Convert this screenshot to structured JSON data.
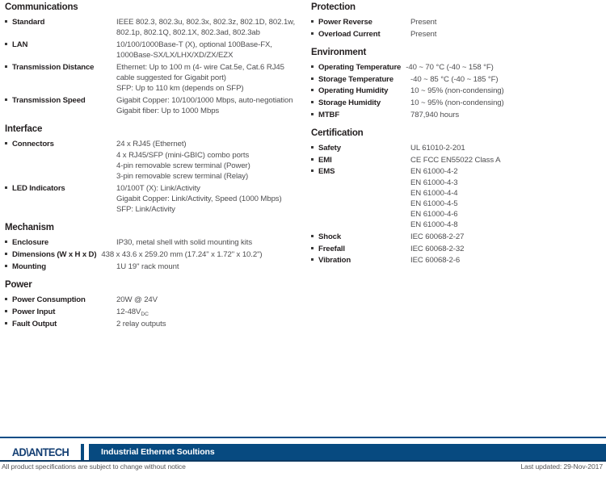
{
  "columns": {
    "left": [
      {
        "title": "Communications",
        "rows": [
          {
            "label": "Standard",
            "value": "IEEE 802.3, 802.3u, 802.3x, 802.3z, 802.1D, 802.1w,\n802.1p, 802.1Q, 802.1X, 802.3ad, 802.3ab"
          },
          {
            "label": "LAN",
            "value": "10/100/1000Base-T (X), optional 100Base-FX,\n1000Base-SX/LX/LHX/XD/ZX/EZX"
          },
          {
            "label": "Transmission Distance",
            "value": "Ethernet: Up to 100 m (4- wire Cat.5e, Cat.6 RJ45\ncable suggested for Gigabit port)\nSFP: Up to 110 km (depends on SFP)"
          },
          {
            "label": "Transmission Speed",
            "value": "Gigabit Copper: 10/100/1000 Mbps, auto-negotiation\nGigabit fiber: Up to 1000 Mbps"
          }
        ]
      },
      {
        "title": "Interface",
        "rows": [
          {
            "label": "Connectors",
            "value": "24 x RJ45 (Ethernet)\n4 x RJ45/SFP (mini-GBIC) combo ports\n4-pin removable screw terminal (Power)\n3-pin removable screw terminal (Relay)"
          },
          {
            "label": "LED Indicators",
            "value": "10/100T (X): Link/Activity\nGigabit Copper: Link/Activity, Speed (1000 Mbps)\nSFP: Link/Activity"
          }
        ]
      },
      {
        "title": "Mechanism",
        "rows": [
          {
            "label": "Enclosure",
            "value": "IP30, metal shell with solid mounting kits"
          },
          {
            "label": "Dimensions (W x H x D)",
            "value": "438 x 43.6 x 259.20 mm (17.24\" x 1.72\" x 10.2\")",
            "wide": true
          },
          {
            "label": "Mounting",
            "value": "1U 19\" rack mount"
          }
        ]
      },
      {
        "title": "Power",
        "rows": [
          {
            "label": "Power Consumption",
            "value": "20W @ 24V"
          },
          {
            "label": "Power Input",
            "value": "12-48V",
            "subscript": "DC"
          },
          {
            "label": "Fault Output",
            "value": "2 relay outputs"
          }
        ]
      }
    ],
    "right": [
      {
        "title": "Protection",
        "rows": [
          {
            "label": "Power Reverse",
            "value": "Present"
          },
          {
            "label": "Overload Current",
            "value": "Present"
          }
        ]
      },
      {
        "title": "Environment",
        "rows": [
          {
            "label": "Operating Temperature",
            "value": "-40 ~ 70 °C (-40 ~ 158 °F)",
            "wide": true
          },
          {
            "label": "Storage Temperature",
            "value": "-40 ~ 85 °C (-40 ~ 185 °F)"
          },
          {
            "label": "Operating Humidity",
            "value": "10 ~ 95% (non-condensing)"
          },
          {
            "label": "Storage Humidity",
            "value": "10 ~ 95% (non-condensing)"
          },
          {
            "label": "MTBF",
            "value": "787,940 hours"
          }
        ]
      },
      {
        "title": "Certification",
        "rows": [
          {
            "label": "Safety",
            "value": "UL 61010-2-201"
          },
          {
            "label": "EMI",
            "value": "CE FCC EN55022 Class A"
          },
          {
            "label": "EMS",
            "value": "EN 61000-4-2\nEN 61000-4-3\nEN 61000-4-4\nEN 61000-4-5\nEN 61000-4-6\nEN 61000-4-8"
          },
          {
            "label": "Shock",
            "value": "IEC 60068-2-27"
          },
          {
            "label": "Freefall",
            "value": "IEC 60068-2-32"
          },
          {
            "label": "Vibration",
            "value": "IEC 60068-2-6"
          }
        ]
      }
    ]
  },
  "footer": {
    "logo": "AD\\ANTECH",
    "band_title": "Industrial Ethernet Soultions",
    "note": "All product specifications are subject to change without notice",
    "updated": "Last updated: 29-Nov-2017",
    "band_color": "#074a80",
    "logo_color": "#123d72"
  }
}
